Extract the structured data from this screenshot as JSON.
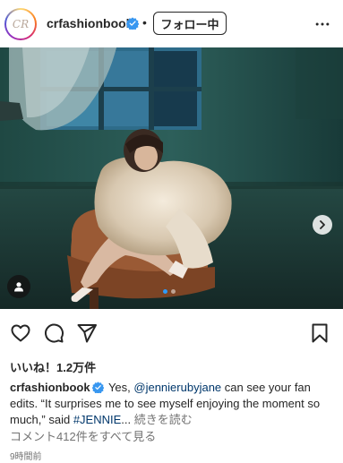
{
  "header": {
    "avatar_mark": "CR",
    "username": "crfashionbook",
    "separator": "•",
    "follow_label": "フォロー中"
  },
  "post": {
    "carousel": {
      "total": 2,
      "active": 1
    }
  },
  "likes": {
    "prefix": "いいね！",
    "count": "1.2万件"
  },
  "caption": {
    "username": "crfashionbook",
    "text_1": " Yes, ",
    "mention": "@jennierubyjane",
    "text_2": " can see your fan edits. “It surprises me to see myself enjoying the moment so much,” said ",
    "hashtag": "#JENNIE",
    "ellipsis": "...",
    "more_label": " 続きを読む"
  },
  "comments": {
    "label": "コメント412件をすべて見る"
  },
  "timestamp": "9時間前",
  "colors": {
    "accent": "#0095f6",
    "verified": "#3897f0",
    "link": "#00376b",
    "secondary": "#737373"
  }
}
